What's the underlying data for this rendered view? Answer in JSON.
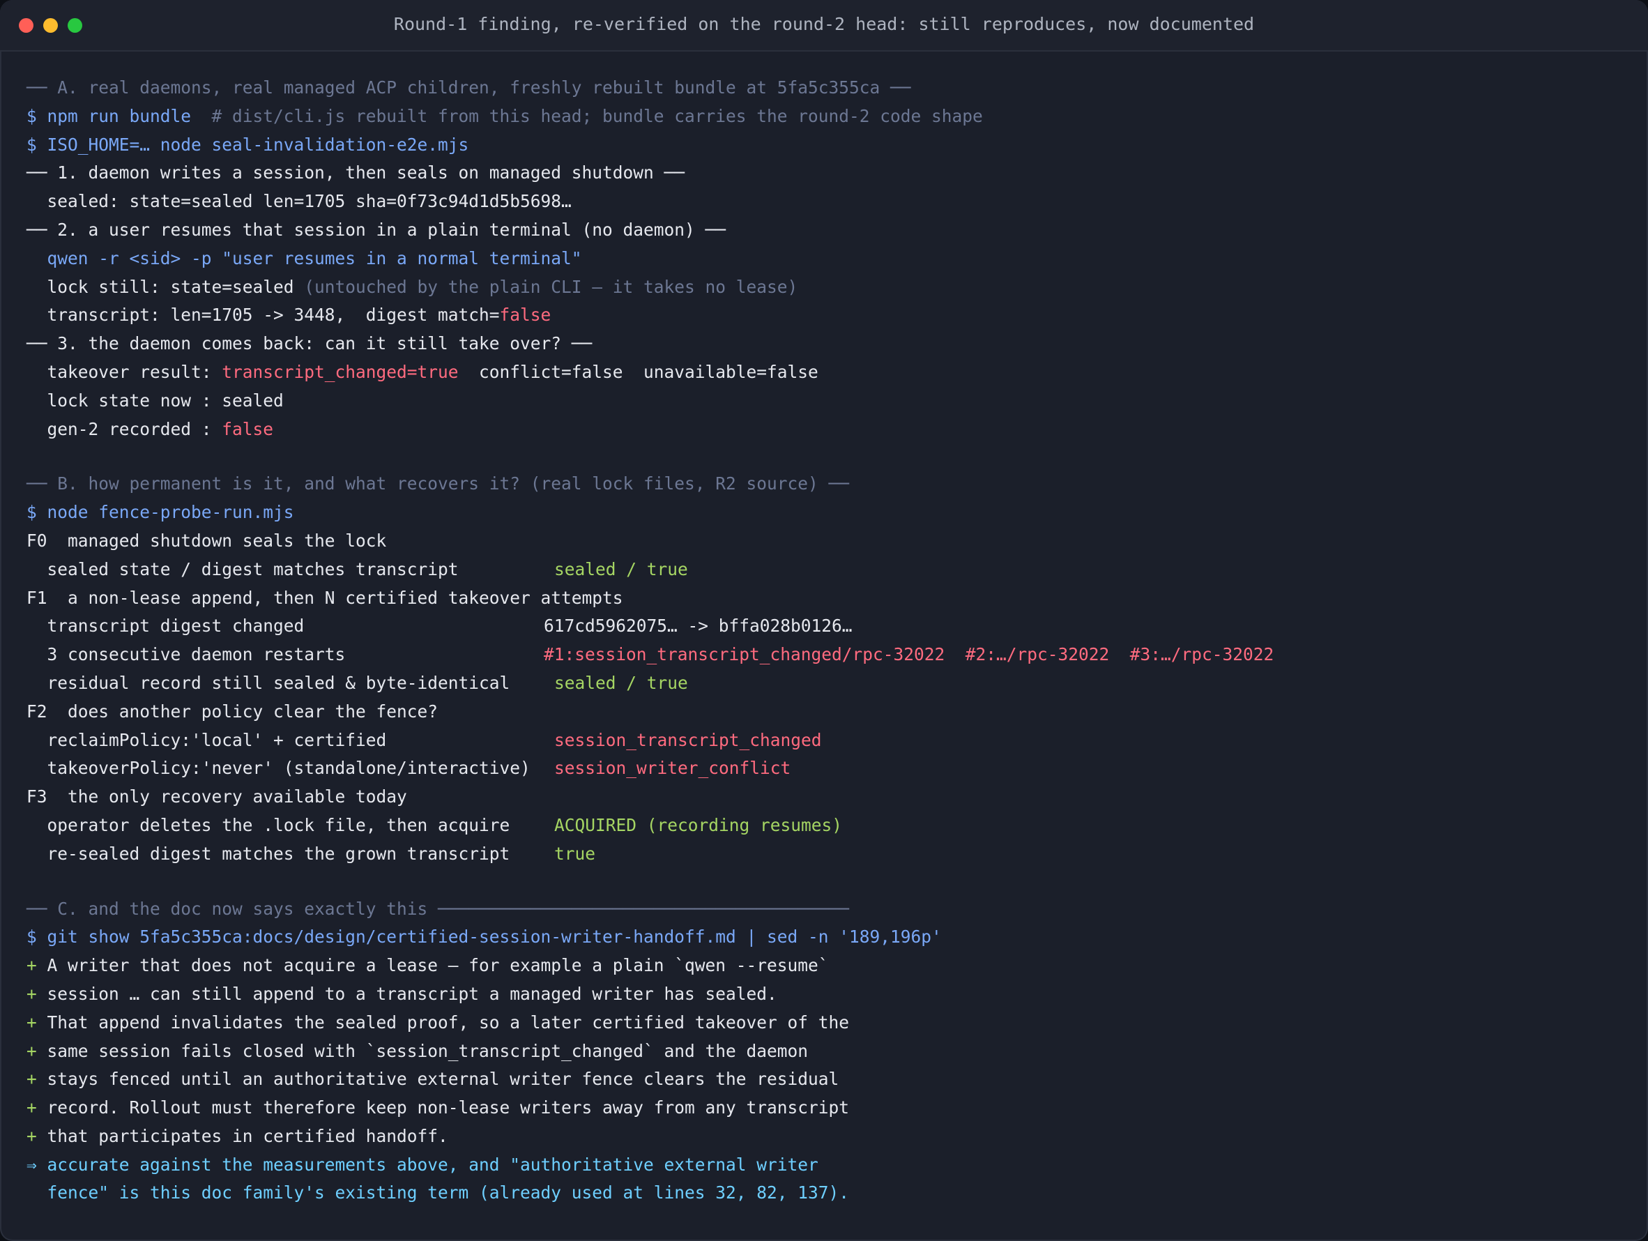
{
  "window": {
    "title": "Round-1 finding, re-verified on the round-2 head: still reproduces, now documented"
  },
  "lines": {
    "secA_header": "── A. real daemons, real managed ACP children, freshly rebuilt bundle at 5fa5c355ca ──",
    "cmd_bundle": "$ npm run bundle",
    "cmd_bundle_comment": "  # dist/cli.js rebuilt from this head; bundle carries the round-2 code shape",
    "cmd_seal": "$ ISO_HOME=… node seal-invalidation-e2e.mjs",
    "step1": "── 1. daemon writes a session, then seals on managed shutdown ──",
    "step1_sealed": "  sealed: state=sealed len=1705 sha=0f73c94d1d5b5698…",
    "step2": "── 2. a user resumes that session in a plain terminal (no daemon) ──",
    "step2_cmd": "  qwen -r <sid> -p \"user resumes in a normal terminal\"",
    "step2_lock": "  lock still: state=sealed ",
    "step2_lock_note": "(untouched by the plain CLI — it takes no lease)",
    "step2_transcript": "  transcript: len=1705 -> 3448,  digest match=",
    "step2_transcript_val": "false",
    "step3": "── 3. the daemon comes back: can it still take over? ──",
    "step3_takeover": "  takeover result: ",
    "step3_takeover_red": "transcript_changed=true",
    "step3_takeover_rest": "  conflict=false  unavailable=false",
    "step3_lock": "  lock state now : sealed",
    "step3_gen": "  gen-2 recorded : ",
    "step3_gen_val": "false",
    "secB_header": "── B. how permanent is it, and what recovers it? (real lock files, R2 source) ──",
    "cmd_fence": "$ node fence-probe-run.mjs",
    "f0": "F0  managed shutdown seals the lock",
    "f0_a": "  sealed state / digest matches transcript",
    "f0_a_val": "sealed / true",
    "f1": "F1  a non-lease append, then N certified takeover attempts",
    "f1_a": "  transcript digest changed",
    "f1_a_val": "617cd5962075… -> bffa028b0126…",
    "f1_b": "  3 consecutive daemon restarts",
    "f1_b_val": "#1:session_transcript_changed/rpc-32022  #2:…/rpc-32022  #3:…/rpc-32022",
    "f1_c": "  residual record still sealed & byte-identical",
    "f1_c_val": "sealed / true",
    "f2": "F2  does another policy clear the fence?",
    "f2_a": "  reclaimPolicy:'local' + certified",
    "f2_a_val": "session_transcript_changed",
    "f2_b": "  takeoverPolicy:'never' (standalone/interactive)",
    "f2_b_val": "session_writer_conflict",
    "f3": "F3  the only recovery available today",
    "f3_a": "  operator deletes the .lock file, then acquire",
    "f3_a_val": "ACQUIRED (recording resumes)",
    "f3_b": "  re-sealed digest matches the grown transcript",
    "f3_b_val": "true",
    "secC_header": "── C. and the doc now says exactly this ────────────────────────────────────────",
    "cmd_git": "$ git show 5fa5c355ca:docs/design/certified-session-writer-handoff.md | sed -n '189,196p'",
    "doc_1": " A writer that does not acquire a lease — for example a plain `qwen --resume`",
    "doc_2": " session … can still append to a transcript a managed writer has sealed.",
    "doc_3": " That append invalidates the sealed proof, so a later certified takeover of the",
    "doc_4": " same session fails closed with `session_transcript_changed` and the daemon",
    "doc_5": " stays fenced until an authoritative external writer fence clears the residual",
    "doc_6": " record. Rollout must therefore keep non-lease writers away from any transcript",
    "doc_7": " that participates in certified handoff.",
    "plus": "+",
    "conclusion_1": "⇒ accurate against the measurements above, and \"authoritative external writer",
    "conclusion_2": "  fence\" is this doc family's existing term (already used at lines 32, 82, 137)."
  },
  "colors": {
    "background": "#1b1f2a",
    "comment": "#6c7793",
    "command": "#7aa8f7",
    "error": "#ff6b7f",
    "success": "#a5d563",
    "conclusion": "#6ecfff"
  }
}
